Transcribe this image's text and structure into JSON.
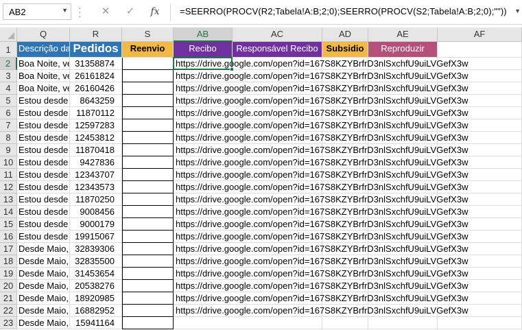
{
  "formula_bar": {
    "name_box": "AB2",
    "fx_label": "fx",
    "formula": "=SEERRO(PROCV(R2;Tabela!A:B;2;0);SEERRO(PROCV(S2;Tabela!A:B;2;0);\"\"))"
  },
  "columns": [
    {
      "id": "Q",
      "label": "Q"
    },
    {
      "id": "R",
      "label": "R"
    },
    {
      "id": "S",
      "label": "S"
    },
    {
      "id": "AB",
      "label": "AB"
    },
    {
      "id": "AC",
      "label": "AC"
    },
    {
      "id": "AD",
      "label": "AD"
    },
    {
      "id": "AE",
      "label": "AE"
    },
    {
      "id": "AF",
      "label": "AF"
    }
  ],
  "headers": {
    "Q": "Descrição da",
    "R": "Pedidos",
    "S": "Reenvio",
    "AB": "Recibo",
    "AC": "Responsável Recibo",
    "AD": "Subsidio",
    "AE": "Reproduzir"
  },
  "header_colors": {
    "Q": "#2e75b6",
    "R": "#2e75b6",
    "S": "#f4b942",
    "AB": "#7030a0",
    "AC": "#7030a0",
    "AD": "#f4b942",
    "AE": "#b4507a"
  },
  "rows": [
    {
      "n": "1"
    },
    {
      "n": "2",
      "q": "Boa Noite, ve",
      "r": "31358874",
      "ab": "https://drive.google.com/open?id=167S8KZYBrfrD3nlSxchfU9uiLVGefX3w"
    },
    {
      "n": "3",
      "q": "Boa Noite, ve",
      "r": "26161824",
      "ab": "https://drive.google.com/open?id=167S8KZYBrfrD3nlSxchfU9uiLVGefX3w"
    },
    {
      "n": "4",
      "q": "Boa Noite, ve",
      "r": "26160426",
      "ab": "https://drive.google.com/open?id=167S8KZYBrfrD3nlSxchfU9uiLVGefX3w"
    },
    {
      "n": "5",
      "q": "Estou desde",
      "r": "8643259",
      "ab": "https://drive.google.com/open?id=167S8KZYBrfrD3nlSxchfU9uiLVGefX3w"
    },
    {
      "n": "6",
      "q": "Estou desde",
      "r": "11870112",
      "ab": "https://drive.google.com/open?id=167S8KZYBrfrD3nlSxchfU9uiLVGefX3w"
    },
    {
      "n": "7",
      "q": "Estou desde",
      "r": "12597283",
      "ab": "https://drive.google.com/open?id=167S8KZYBrfrD3nlSxchfU9uiLVGefX3w"
    },
    {
      "n": "8",
      "q": "Estou desde",
      "r": "12453812",
      "ab": "https://drive.google.com/open?id=167S8KZYBrfrD3nlSxchfU9uiLVGefX3w"
    },
    {
      "n": "9",
      "q": "Estou desde",
      "r": "11870418",
      "ab": "https://drive.google.com/open?id=167S8KZYBrfrD3nlSxchfU9uiLVGefX3w"
    },
    {
      "n": "10",
      "q": "Estou desde",
      "r": "9427836",
      "ab": "https://drive.google.com/open?id=167S8KZYBrfrD3nlSxchfU9uiLVGefX3w"
    },
    {
      "n": "11",
      "q": "Estou desde",
      "r": "12343707",
      "ab": "https://drive.google.com/open?id=167S8KZYBrfrD3nlSxchfU9uiLVGefX3w"
    },
    {
      "n": "12",
      "q": "Estou desde",
      "r": "12343573",
      "ab": "https://drive.google.com/open?id=167S8KZYBrfrD3nlSxchfU9uiLVGefX3w"
    },
    {
      "n": "13",
      "q": "Estou desde",
      "r": "11870250",
      "ab": "https://drive.google.com/open?id=167S8KZYBrfrD3nlSxchfU9uiLVGefX3w"
    },
    {
      "n": "14",
      "q": "Estou desde",
      "r": "9008456",
      "ab": "https://drive.google.com/open?id=167S8KZYBrfrD3nlSxchfU9uiLVGefX3w"
    },
    {
      "n": "15",
      "q": "Estou desde",
      "r": "9000179",
      "ab": "https://drive.google.com/open?id=167S8KZYBrfrD3nlSxchfU9uiLVGefX3w"
    },
    {
      "n": "16",
      "q": "Estou desde",
      "r": "19915067",
      "ab": "https://drive.google.com/open?id=167S8KZYBrfrD3nlSxchfU9uiLVGefX3w"
    },
    {
      "n": "17",
      "q": "Desde Maio,",
      "r": "32839306",
      "ab": "https://drive.google.com/open?id=167S8KZYBrfrD3nlSxchfU9uiLVGefX3w"
    },
    {
      "n": "18",
      "q": "Desde Maio,",
      "r": "32835500",
      "ab": "https://drive.google.com/open?id=167S8KZYBrfrD3nlSxchfU9uiLVGefX3w"
    },
    {
      "n": "19",
      "q": "Desde Maio,",
      "r": "31453654",
      "ab": "https://drive.google.com/open?id=167S8KZYBrfrD3nlSxchfU9uiLVGefX3w"
    },
    {
      "n": "20",
      "q": "Desde Maio,",
      "r": "20538276",
      "ab": "https://drive.google.com/open?id=167S8KZYBrfrD3nlSxchfU9uiLVGefX3w"
    },
    {
      "n": "21",
      "q": "Desde Maio,",
      "r": "18920985",
      "ab": "https://drive.google.com/open?id=167S8KZYBrfrD3nlSxchfU9uiLVGefX3w"
    },
    {
      "n": "22",
      "q": "Desde Maio,",
      "r": "16882952",
      "ab": "https://drive.google.com/open?id=167S8KZYBrfrD3nlSxchfU9uiLVGefX3w"
    },
    {
      "n": "23",
      "q": "Desde Maio,",
      "r": "15941164",
      "ab": ""
    }
  ],
  "selected": {
    "col": "AB",
    "row": "2"
  }
}
